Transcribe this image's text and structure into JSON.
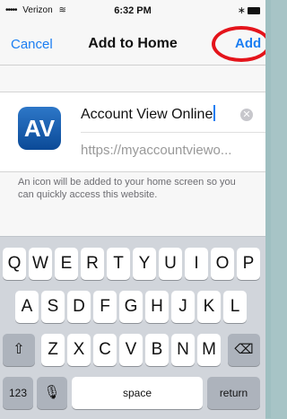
{
  "status_bar": {
    "carrier": "Verizon",
    "signal_dots": "•••••",
    "time": "6:32 PM"
  },
  "nav": {
    "cancel_label": "Cancel",
    "title": "Add to Home",
    "add_label": "Add"
  },
  "form": {
    "icon_text": "AV",
    "name_value": "Account View Online",
    "url_value": "https://myaccountviewo..."
  },
  "help_text": "An icon will be added to your home screen so you can quickly access this website.",
  "keyboard": {
    "row1": [
      "Q",
      "W",
      "E",
      "R",
      "T",
      "Y",
      "U",
      "I",
      "O",
      "P"
    ],
    "row2": [
      "A",
      "S",
      "D",
      "F",
      "G",
      "H",
      "J",
      "K",
      "L"
    ],
    "row3": [
      "Z",
      "X",
      "C",
      "V",
      "B",
      "N",
      "M"
    ],
    "numbers_label": "123",
    "space_label": "space",
    "return_label": "return"
  },
  "colors": {
    "accent": "#1a7ef2",
    "highlight_circle": "#e4141b",
    "icon_blue": "#0b4a97"
  }
}
